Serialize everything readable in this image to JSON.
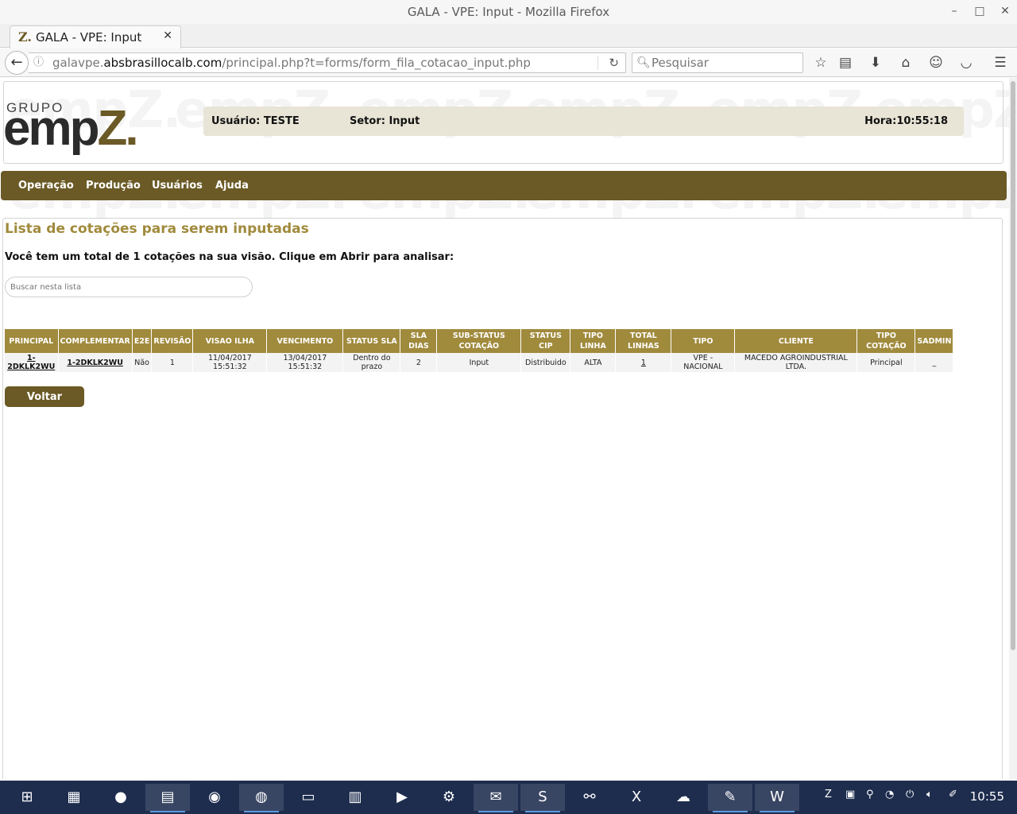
{
  "window": {
    "title": "GALA - VPE: Input - Mozilla Firefox",
    "controls": [
      "–",
      "□",
      "✕"
    ]
  },
  "browser": {
    "tab_title": "GALA - VPE: Input",
    "tab_favicon": "Z.",
    "url_prefix": "galavpe.",
    "url_domain": "absbrasillocalb.com",
    "url_path": "/principal.php?t=forms/form_fila_cotacao_input.php",
    "search_placeholder": "Pesquisar"
  },
  "header": {
    "logo_grupo": "GRUPO",
    "logo_emp": "emp",
    "logo_z": "Z.",
    "usuario": "Usuário: TESTE",
    "setor": "Setor: Input",
    "hora": "Hora:10:55:18"
  },
  "menu": [
    "Operação",
    "Produção",
    "Usuários",
    "Ajuda"
  ],
  "main": {
    "title": "Lista de cotações para serem inputadas",
    "subtitle": "Você tem um total de 1 cotações na sua visão. Clique em Abrir para analisar:",
    "search_placeholder": "Buscar nesta lista",
    "back_button": "Voltar"
  },
  "table": {
    "columns": [
      "PRINCIPAL",
      "COMPLEMENTAR",
      "E2E",
      "REVISÃO",
      "VISAO ILHA",
      "VENCIMENTO",
      "STATUS SLA",
      "SLA DIAS",
      "SUB-STATUS COTAÇÃO",
      "STATUS CIP",
      "TIPO LINHA",
      "TOTAL LINHAS",
      "TIPO",
      "CLIENTE",
      "TIPO COTAÇÃO",
      "SADMIN"
    ],
    "rows": [
      [
        "1-2DKLK2WU",
        "1-2DKLK2WU",
        "Não",
        "1",
        "11/04/2017 15:51:32",
        "13/04/2017 15:51:32",
        "Dentro do prazo",
        "2",
        "Input",
        "Distribuido",
        "ALTA",
        "1",
        "VPE - NACIONAL",
        "MACEDO AGROINDUSTRIAL LTDA.",
        "Principal",
        "_"
      ]
    ]
  },
  "taskbar": {
    "apps": [
      "apps-icon",
      "files-icon",
      "screen-recorder-icon",
      "file-manager-icon",
      "chrome-icon",
      "firefox-icon",
      "terminal-icon",
      "archive-icon",
      "video-icon",
      "settings-icon",
      "outlook-icon",
      "sublime-icon",
      "remote-icon",
      "excel-icon",
      "cloud-icon",
      "notepad-icon",
      "word-icon"
    ],
    "clock": "10:55"
  },
  "colors": {
    "brand": "#6b5a26",
    "header_accent": "#a08a3c",
    "taskbar": "#1e2d4e"
  }
}
